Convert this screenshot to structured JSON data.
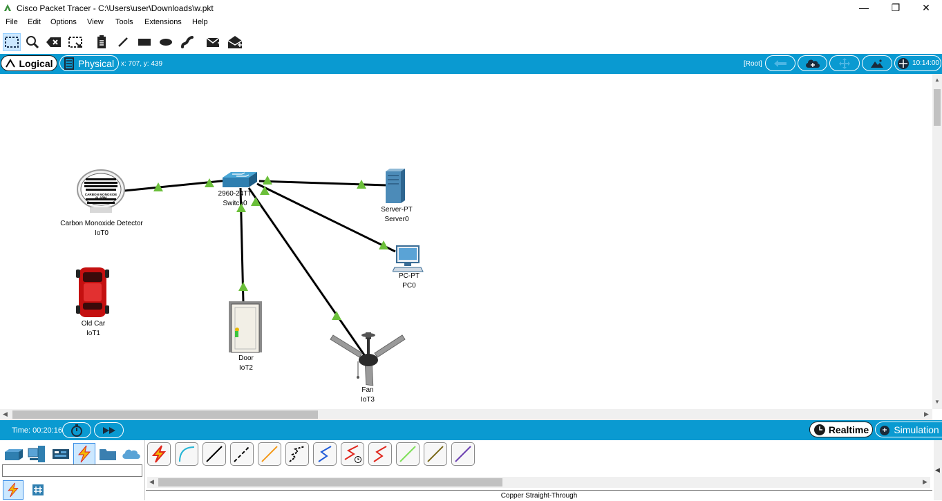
{
  "window": {
    "title": "Cisco Packet Tracer - C:\\Users\\user\\Downloads\\w.pkt",
    "minimize": "—",
    "maximize": "❐",
    "close": "✕"
  },
  "menu": [
    "File",
    "Edit",
    "Options",
    "View",
    "Tools",
    "Extensions",
    "Help"
  ],
  "toolbar": [
    "select-icon",
    "inspect-icon",
    "delete-icon",
    "resize-icon",
    "note-icon",
    "draw-line-icon",
    "rectangle-icon",
    "ellipse-icon",
    "freeform-icon",
    "add-simple-pdu-icon",
    "add-complex-pdu-icon"
  ],
  "workspace": {
    "logical_label": "Logical",
    "physical_label": "Physical",
    "coords": "x: 707, y: 439",
    "root_label": "[Root]",
    "clock": "10:14:00"
  },
  "devices": [
    {
      "id": "co",
      "type": "Carbon Monoxide Detector",
      "name": "IoT0",
      "alarm_text": "CARBON MONOXIDE ALARM"
    },
    {
      "id": "switch",
      "type": "2960-24TT",
      "name": "Switch0"
    },
    {
      "id": "server",
      "type": "Server-PT",
      "name": "Server0"
    },
    {
      "id": "pc",
      "type": "PC-PT",
      "name": "PC0"
    },
    {
      "id": "car",
      "type": "Old Car",
      "name": "IoT1"
    },
    {
      "id": "door",
      "type": "Door",
      "name": "IoT2"
    },
    {
      "id": "fan",
      "type": "Fan",
      "name": "IoT3"
    }
  ],
  "links": [
    {
      "from": "co",
      "to": "switch",
      "status": "up"
    },
    {
      "from": "switch",
      "to": "server",
      "status": "up"
    },
    {
      "from": "switch",
      "to": "pc",
      "status": "up"
    },
    {
      "from": "switch",
      "to": "door",
      "status": "up"
    },
    {
      "from": "switch",
      "to": "fan",
      "status": "up"
    }
  ],
  "timebar": {
    "time": "Time: 00:20:16",
    "realtime": "Realtime",
    "simulation": "Simulation"
  },
  "device_categories": [
    "network-devices-icon",
    "end-devices-icon",
    "components-icon",
    "connections-icon",
    "miscellaneous-icon",
    "multiuser-icon"
  ],
  "cable_types": [
    {
      "icon": "automatic-connection-icon",
      "color": "#e0261c"
    },
    {
      "icon": "console-cable-icon",
      "color": "#27b6d6"
    },
    {
      "icon": "copper-straight-through-icon",
      "color": "#000000"
    },
    {
      "icon": "copper-cross-over-icon",
      "color": "#000000"
    },
    {
      "icon": "fiber-icon",
      "color": "#f39a1c"
    },
    {
      "icon": "phone-cable-icon",
      "color": "#000000"
    },
    {
      "icon": "coaxial-icon",
      "color": "#1f5bd8"
    },
    {
      "icon": "serial-dce-icon",
      "color": "#e0261c"
    },
    {
      "icon": "serial-dte-icon",
      "color": "#e0261c"
    },
    {
      "icon": "octal-cable-icon",
      "color": "#7fe05a"
    },
    {
      "icon": "iot-custom-cable-icon",
      "color": "#7a6a1c"
    },
    {
      "icon": "usb-cable-icon",
      "color": "#6b3fb0"
    }
  ],
  "selected_cable": "Copper Straight-Through",
  "colors": {
    "accent": "#0a9ad1",
    "link": "#000000",
    "link_up": "#6bbf3a"
  }
}
